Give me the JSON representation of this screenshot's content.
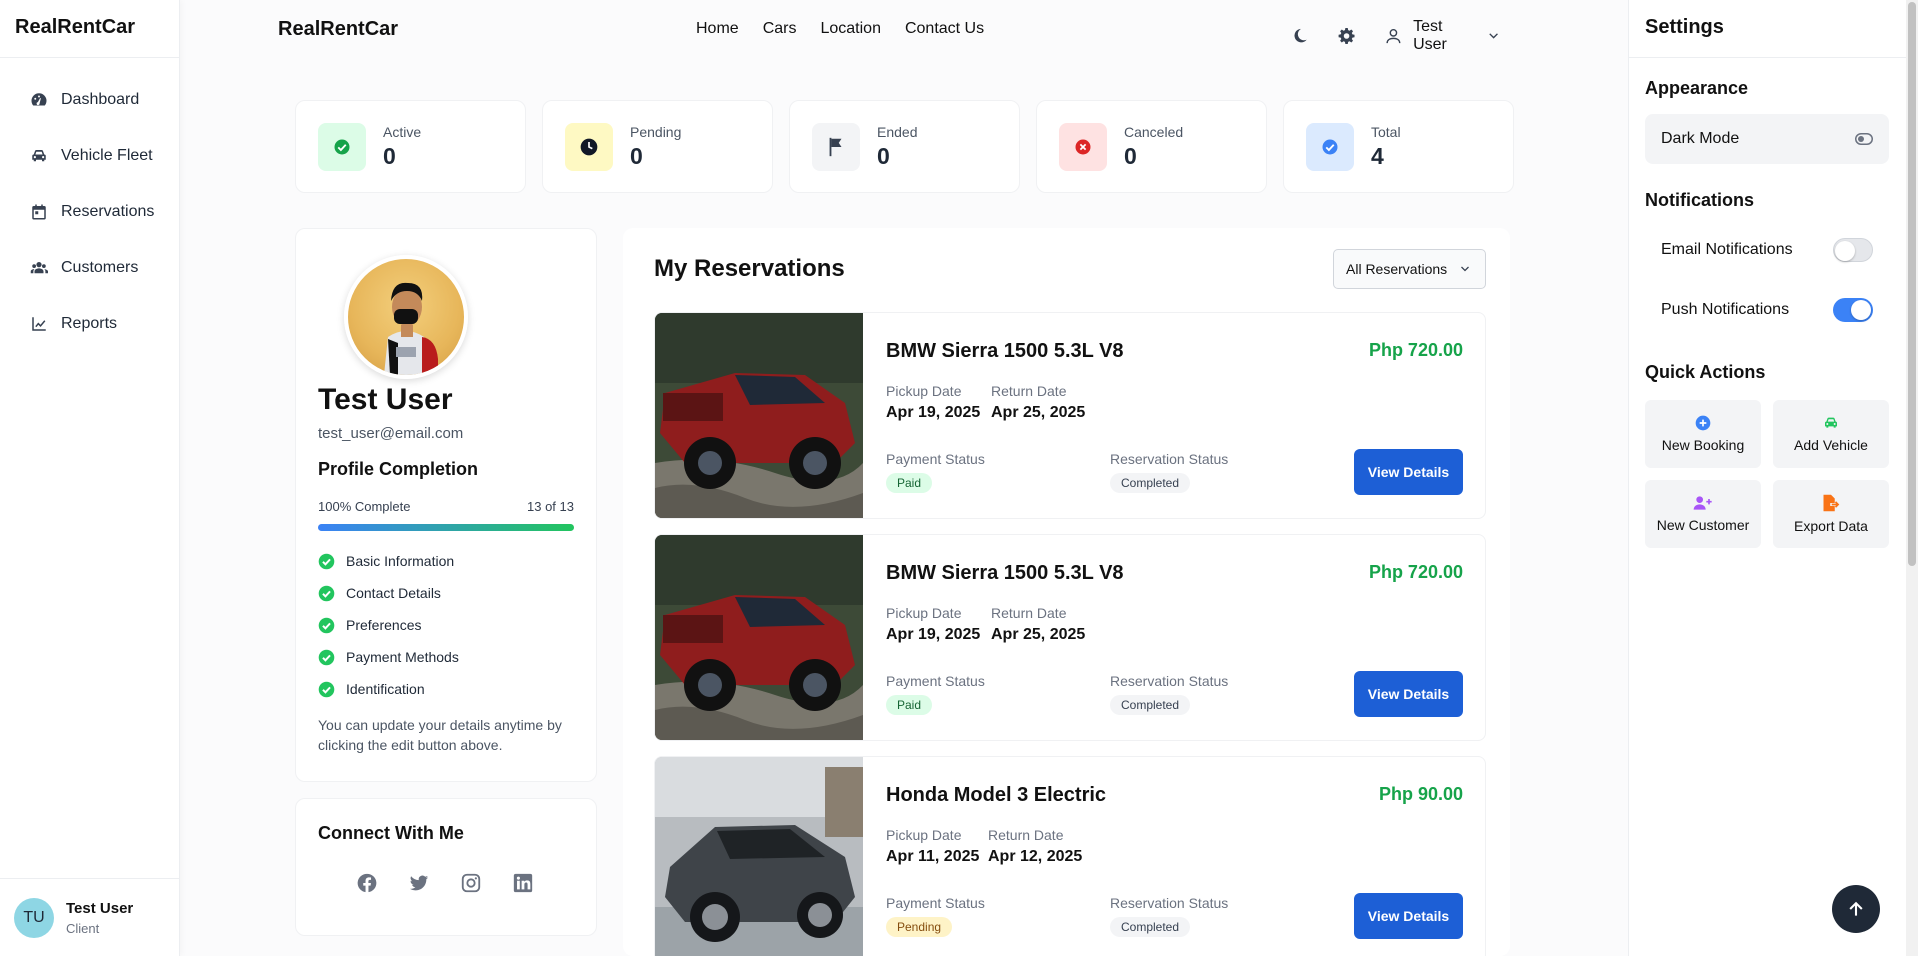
{
  "sidebar": {
    "brand": "RealRentCar",
    "items": [
      {
        "label": "Dashboard",
        "icon": "dashboard-icon"
      },
      {
        "label": "Vehicle Fleet",
        "icon": "car-icon"
      },
      {
        "label": "Reservations",
        "icon": "calendar-icon"
      },
      {
        "label": "Customers",
        "icon": "users-icon"
      },
      {
        "label": "Reports",
        "icon": "chart-line-icon"
      }
    ],
    "user": {
      "initials": "TU",
      "name": "Test User",
      "role": "Client"
    }
  },
  "topnav": {
    "brand": "RealRentCar",
    "links": [
      "Home",
      "Cars",
      "Location",
      "Contact Us"
    ],
    "user_name": "Test User"
  },
  "stats": [
    {
      "label": "Active",
      "value": "0",
      "icon": "check-icon",
      "bg": "#dcfce7",
      "fg": "#16a34a"
    },
    {
      "label": "Pending",
      "value": "0",
      "icon": "clock-icon",
      "bg": "#fef9c3",
      "fg": "#111827"
    },
    {
      "label": "Ended",
      "value": "0",
      "icon": "flag-icon",
      "bg": "#f3f4f6",
      "fg": "#374151"
    },
    {
      "label": "Canceled",
      "value": "0",
      "icon": "x-circle-icon",
      "bg": "#fee2e2",
      "fg": "#dc2626"
    },
    {
      "label": "Total",
      "value": "4",
      "icon": "check-circle-icon",
      "bg": "#dbeafe",
      "fg": "#3b82f6"
    }
  ],
  "profile": {
    "name": "Test User",
    "email": "test_user@email.com",
    "completion_title": "Profile Completion",
    "completion_text": "100% Complete",
    "completion_count": "13 of 13",
    "completion_fraction": 1.0,
    "checklist": [
      "Basic Information",
      "Contact Details",
      "Preferences",
      "Payment Methods",
      "Identification"
    ],
    "note": "You can update your details anytime by clicking the edit button above."
  },
  "connect": {
    "title": "Connect With Me",
    "icons": [
      "facebook-icon",
      "twitter-icon",
      "instagram-icon",
      "linkedin-icon"
    ]
  },
  "reservations": {
    "title": "My Reservations",
    "filter": "All Reservations",
    "labels": {
      "pickup": "Pickup Date",
      "return": "Return Date",
      "payment": "Payment Status",
      "status": "Reservation Status",
      "button": "View Details"
    },
    "items": [
      {
        "car": "BMW Sierra 1500 5.3L V8",
        "price": "Php 720.00",
        "pickup": "Apr 19, 2025",
        "return": "Apr 25, 2025",
        "payment": "Paid",
        "status": "Completed",
        "image": "red-pickup-truck"
      },
      {
        "car": "BMW Sierra 1500 5.3L V8",
        "price": "Php 720.00",
        "pickup": "Apr 19, 2025",
        "return": "Apr 25, 2025",
        "payment": "Paid",
        "status": "Completed",
        "image": "red-pickup-truck"
      },
      {
        "car": "Honda Model 3 Electric",
        "price": "Php 90.00",
        "pickup": "Apr 11, 2025",
        "return": "Apr 12, 2025",
        "payment": "Pending",
        "status": "Completed",
        "image": "gray-sedan"
      }
    ]
  },
  "settings": {
    "title": "Settings",
    "appearance_title": "Appearance",
    "dark_mode_label": "Dark Mode",
    "notifications_title": "Notifications",
    "email_label": "Email Notifications",
    "email_on": false,
    "push_label": "Push Notifications",
    "push_on": true,
    "quick_title": "Quick Actions",
    "quick_actions": [
      {
        "label": "New Booking",
        "icon": "plus-circle-icon",
        "color": "#3b82f6"
      },
      {
        "label": "Add Vehicle",
        "icon": "car-icon",
        "color": "#22c55e"
      },
      {
        "label": "New Customer",
        "icon": "user-plus-icon",
        "color": "#a855f7"
      },
      {
        "label": "Export Data",
        "icon": "file-export-icon",
        "color": "#f97316"
      }
    ]
  }
}
